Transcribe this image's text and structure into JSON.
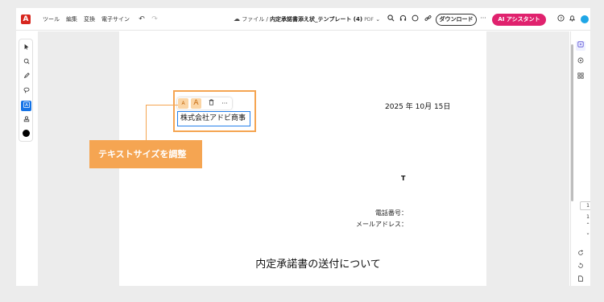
{
  "menu": {
    "tools": "ツール",
    "edit": "編集",
    "convert": "変換",
    "esign": "電子サイン"
  },
  "file": {
    "breadcrumb": "ファイル",
    "separator": "/",
    "name": "内定承諾書添え状_テンプレート (4)",
    "type": "PDF"
  },
  "actions": {
    "download": "ダウンロード",
    "more": "···",
    "ai": "AI アシスタント"
  },
  "icons": {
    "logo": "adobe-acrobat-logo",
    "undo": "↶",
    "redo": "↷"
  },
  "mini_toolbar": {
    "small_a": "A",
    "large_a": "A",
    "more": "···"
  },
  "document": {
    "textbox": "株式会社アドビ商事",
    "date": "2025 年 10月 15日",
    "t_marker": "T",
    "tel_label": "電話番号：",
    "mail_label": "メールアドレス：",
    "heading": "内定承諾書の送付について"
  },
  "callout": {
    "label": "テキストサイズを調整"
  },
  "pagination": {
    "page": "1",
    "total": "1"
  },
  "colors": {
    "accent_orange": "#f5a552",
    "ai_pink": "#e0226e",
    "logo_red": "#d7261e",
    "active_blue": "#1473e6"
  }
}
